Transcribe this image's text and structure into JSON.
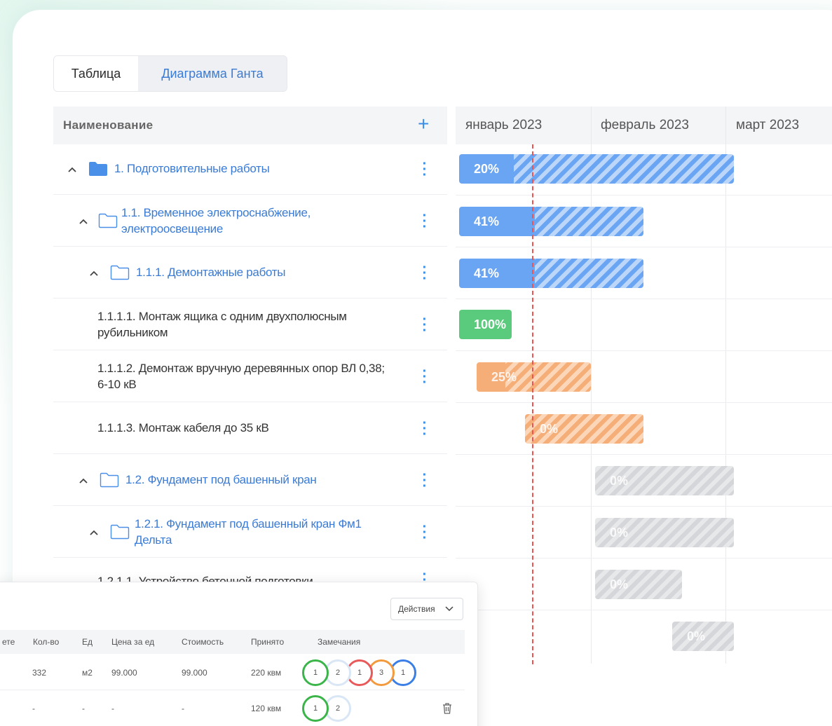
{
  "tabs": [
    {
      "label": "Таблица"
    },
    {
      "label": "Диаграмма Ганта"
    }
  ],
  "table": {
    "header_name": "Наименование",
    "add_icon": "plus-icon",
    "rows": [
      {
        "label": "1. Подготовительные работы",
        "type": "folder-filled",
        "expanded": true
      },
      {
        "label": "1.1. Временное электроснабжение, электроосвещение",
        "type": "folder-outline",
        "expanded": true
      },
      {
        "label": "1.1.1. Демонтажные работы",
        "type": "folder-outline",
        "expanded": true
      },
      {
        "label": "1.1.1.1. Монтаж ящика с одним двухполюсным рубильником",
        "type": "task"
      },
      {
        "label": "1.1.1.2. Демонтаж вручную деревянных опор ВЛ 0,38; 6-10 кВ",
        "type": "task"
      },
      {
        "label": "1.1.1.3. Монтаж кабеля до 35 кВ",
        "type": "task"
      },
      {
        "label": "1.2. Фундамент под башенный кран",
        "type": "folder-outline",
        "expanded": true
      },
      {
        "label": "1.2.1. Фундамент под башенный кран Фм1 Дельта",
        "type": "folder-outline",
        "expanded": true
      },
      {
        "label": "1.2.1.1. Устройство бетонной подготовки",
        "type": "task"
      }
    ]
  },
  "gantt": {
    "months": [
      "январь 2023",
      "февраль 2023",
      "март 2023"
    ],
    "bars": [
      {
        "pct_label": "20%",
        "progress": 0.2,
        "color": "blue"
      },
      {
        "pct_label": "41%",
        "progress": 0.41,
        "color": "blue"
      },
      {
        "pct_label": "41%",
        "progress": 0.41,
        "color": "blue"
      },
      {
        "pct_label": "100%",
        "progress": 1.0,
        "color": "green"
      },
      {
        "pct_label": "25%",
        "progress": 0.25,
        "color": "orange"
      },
      {
        "pct_label": "0%",
        "progress": 0.0,
        "color": "orange"
      },
      {
        "pct_label": "0%",
        "progress": 0.0,
        "color": "grey"
      },
      {
        "pct_label": "0%",
        "progress": 0.0,
        "color": "grey"
      },
      {
        "pct_label": "0%",
        "progress": 0.0,
        "color": "grey"
      },
      {
        "pct_label": "0%",
        "progress": 0.0,
        "color": "grey"
      }
    ],
    "colors": {
      "blue": "#6aa5f3",
      "green": "#5acb7c",
      "orange": "#f6ae78",
      "grey": "#d5d6d9",
      "today": "#ef5350"
    }
  },
  "panel": {
    "actions_label": "Действия",
    "columns": [
      "ете",
      "Кол-во",
      "Ед",
      "Цена за ед",
      "Стоимость",
      "Принято",
      "Замечания"
    ],
    "rows": [
      {
        "qty": "332",
        "unit": "м2",
        "price": "99.000",
        "cost": "99.000",
        "accepted": "220 квм",
        "remarks": [
          {
            "n": "1",
            "color": "#3bb54a"
          },
          {
            "n": "2",
            "color": "#d9e6f5"
          },
          {
            "n": "1",
            "color": "#e85a5a"
          },
          {
            "n": "3",
            "color": "#f29a3c"
          },
          {
            "n": "1",
            "color": "#3a7ee6"
          }
        ]
      },
      {
        "qty": "-",
        "unit": "-",
        "price": "-",
        "cost": "-",
        "accepted": "120 квм",
        "remarks": [
          {
            "n": "1",
            "color": "#3bb54a"
          },
          {
            "n": "2",
            "color": "#d9e6f5"
          }
        ]
      }
    ]
  }
}
